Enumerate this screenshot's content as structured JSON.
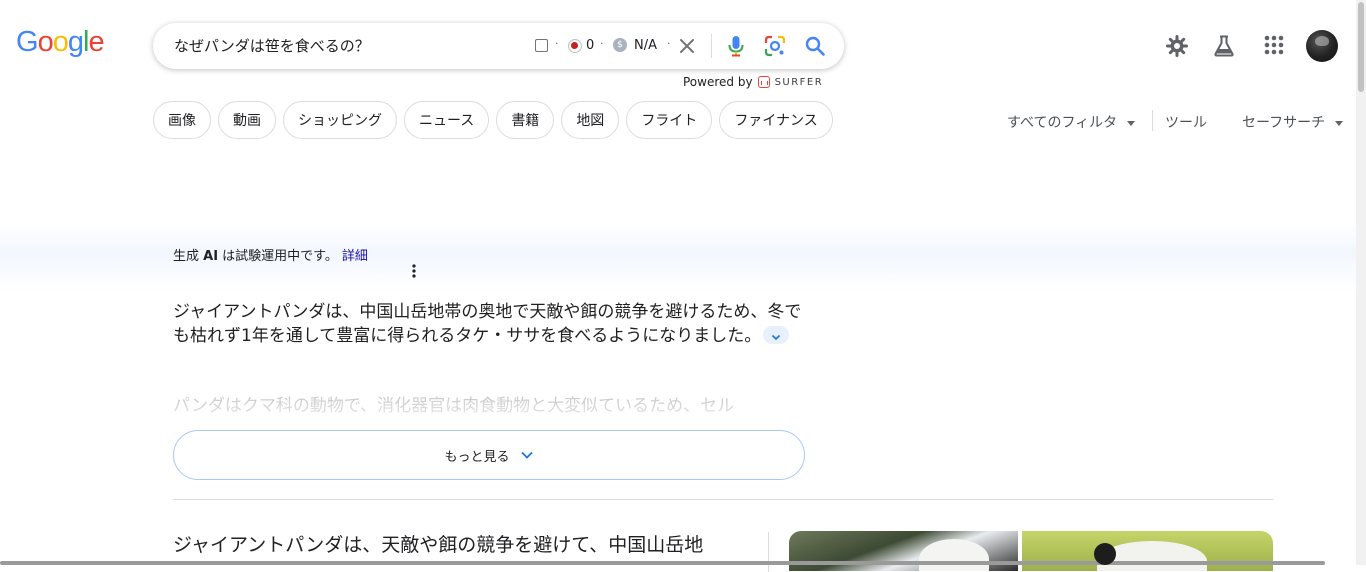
{
  "logo": {
    "letters": [
      "G",
      "o",
      "o",
      "g",
      "l",
      "e"
    ],
    "colors": [
      "#4285F4",
      "#EA4335",
      "#FBBC05",
      "#4285F4",
      "#34A853",
      "#EA4335"
    ]
  },
  "search": {
    "query": "なぜパンダは笹を食べるの？",
    "surfer": {
      "separator": "·",
      "count": "0",
      "currency_symbol": "$",
      "value": "N/A"
    }
  },
  "powered_by": {
    "label": "Powered by",
    "brand": "SURFER"
  },
  "header_icons": [
    "settings-icon",
    "labs-flask-icon",
    "apps-grid-icon"
  ],
  "chips": [
    "画像",
    "動画",
    "ショッピング",
    "ニュース",
    "書籍",
    "地図",
    "フライト",
    "ファイナンス"
  ],
  "tools": {
    "all_filters": "すべてのフィルタ",
    "tools": "ツール",
    "safe_search": "セーフサーチ"
  },
  "ai_overview": {
    "notice_prefix": "生成 ",
    "notice_ai": "AI",
    "notice_suffix": " は試験運用中です。",
    "details_link": "詳細",
    "answer": "ジャイアントパンダは、中国山岳地帯の奥地で天敵や餌の競争を避けるため、冬でも枯れず1年を通して豊富に得られるタケ・ササを食べるようになりました。",
    "faded_text": "パンダはクマ科の動物で、消化器官は肉食動物と大変似ているため、セル",
    "show_more": "もっと見る"
  },
  "snippet": {
    "text": "ジャイアントパンダは、天敵や餌の競争を避けて、中国山岳地"
  },
  "accent_color": "#1a73e8"
}
